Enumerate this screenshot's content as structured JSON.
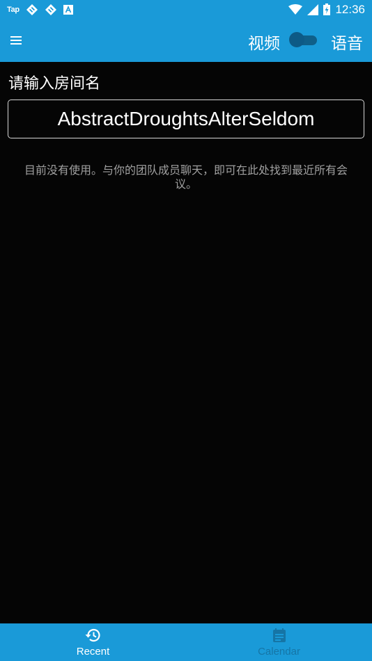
{
  "status_bar": {
    "tap_label": "Tap",
    "time": "12:36",
    "icons": [
      "notification-icon",
      "notification-icon",
      "a-app-icon",
      "wifi-icon",
      "signal-icon",
      "battery-charging-icon"
    ]
  },
  "app_bar": {
    "menu_icon": "hamburger-menu-icon",
    "video_label": "视频",
    "audio_label": "语音",
    "toggle_on": false
  },
  "room": {
    "label": "请输入房间名",
    "value": "AbstractDroughtsAlterSeldom"
  },
  "empty_state": {
    "message": "目前没有使用。与你的团队成员聊天，即可在此处找到最近所有会议。"
  },
  "bottom_nav": {
    "tabs": [
      {
        "label": "Recent",
        "icon": "history-icon",
        "active": true
      },
      {
        "label": "Calendar",
        "icon": "calendar-icon",
        "active": false
      }
    ]
  },
  "colors": {
    "primary": "#1a9ad8",
    "background": "#050505",
    "inactive_tab": "#1575a6"
  }
}
